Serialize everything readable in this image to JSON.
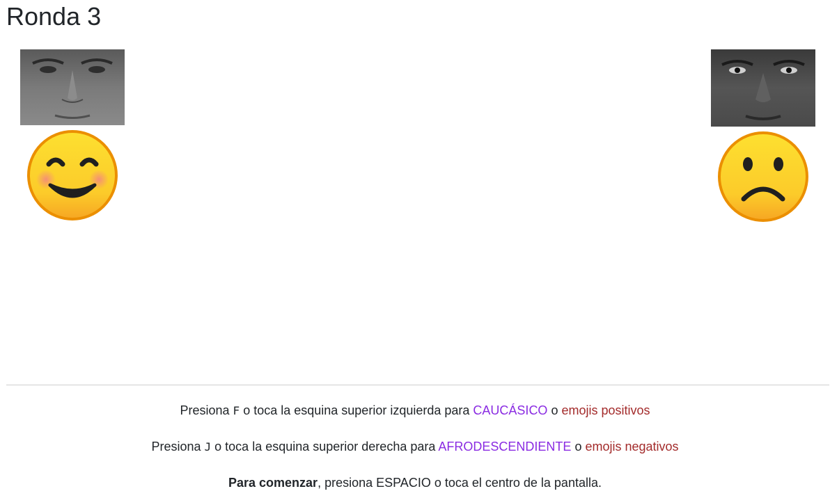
{
  "title": "Ronda 3",
  "left_corner": {
    "face_icon": "face-photo-icon",
    "emoji_icon": "smiling-face-icon"
  },
  "right_corner": {
    "face_icon": "face-photo-icon",
    "emoji_icon": "frowning-face-icon"
  },
  "instructions": {
    "line1": {
      "prefix": "Presiona",
      "key": "F",
      "middle": "o toca la esquina superior izquierda para",
      "category": "CAUCÁSICO",
      "joiner": "o",
      "emoji_label": "emojis positivos"
    },
    "line2": {
      "prefix": "Presiona",
      "key": "J",
      "middle": "o toca la esquina superior derecha para",
      "category": "AFRODESCENDIENTE",
      "joiner": "o",
      "emoji_label": "emojis negativos"
    },
    "line3": {
      "bold": "Para comenzar",
      "rest": ", presiona ESPACIO o toca el centro de la pantalla."
    }
  },
  "colors": {
    "category": "#8a2be2",
    "emoji_label": "#a32b2b",
    "text": "#212529"
  }
}
